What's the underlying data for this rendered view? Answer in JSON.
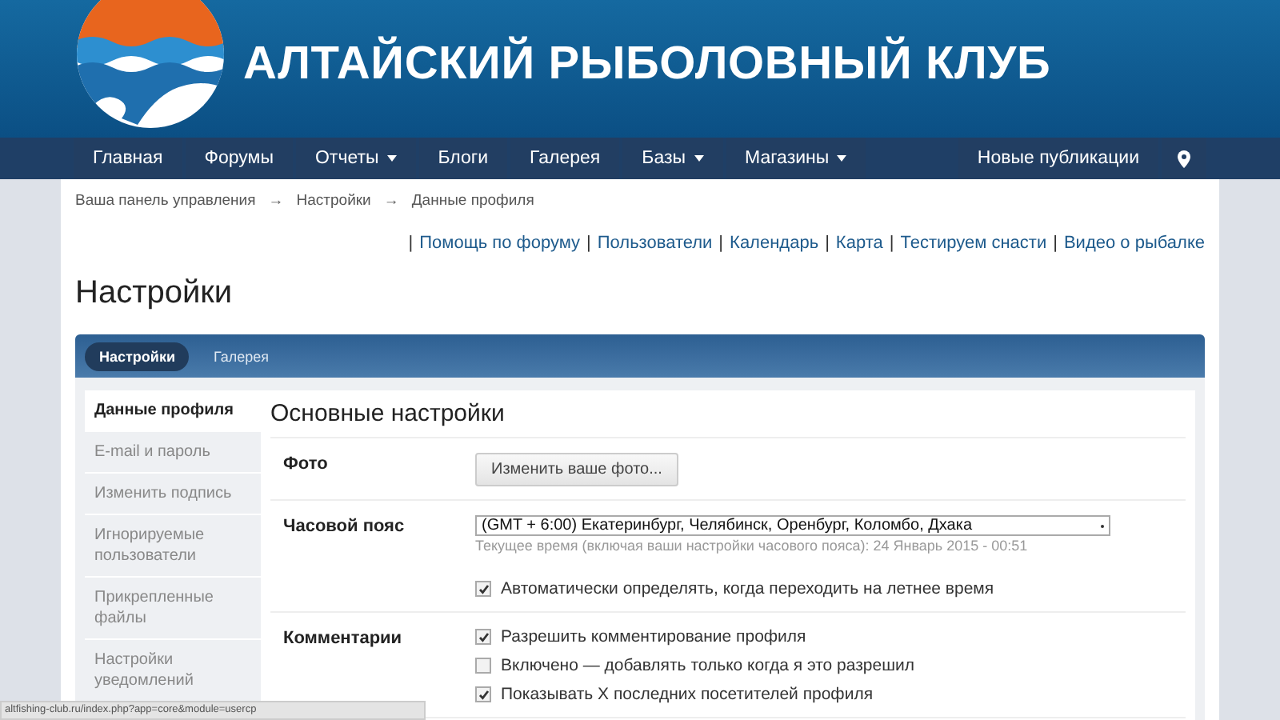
{
  "site_title": "АЛТАЙСКИЙ РЫБОЛОВНЫЙ КЛУБ",
  "nav": {
    "items": [
      {
        "label": "Главная",
        "dropdown": false
      },
      {
        "label": "Форумы",
        "dropdown": false
      },
      {
        "label": "Отчеты",
        "dropdown": true
      },
      {
        "label": "Блоги",
        "dropdown": false
      },
      {
        "label": "Галерея",
        "dropdown": false
      },
      {
        "label": "Базы",
        "dropdown": true
      },
      {
        "label": "Магазины",
        "dropdown": true
      }
    ],
    "right_items": [
      {
        "label": "Новые публикации"
      }
    ]
  },
  "breadcrumb": {
    "separator": "→",
    "items": [
      "Ваша панель управления",
      "Настройки",
      "Данные профиля"
    ]
  },
  "quick_links": {
    "separator": "|",
    "items": [
      "Помощь по форуму",
      "Пользователи",
      "Календарь",
      "Карта",
      "Тестируем снасти",
      "Видео о рыбалке"
    ]
  },
  "page_title": "Настройки",
  "tabs": [
    {
      "label": "Настройки",
      "selected": true
    },
    {
      "label": "Галерея",
      "selected": false
    }
  ],
  "sidebar": {
    "items": [
      {
        "label": "Данные профиля",
        "selected": true
      },
      {
        "label": "E-mail и пароль",
        "selected": false
      },
      {
        "label": "Изменить подпись",
        "selected": false
      },
      {
        "label": "Игнорируемые пользователи",
        "selected": false
      },
      {
        "label": "Прикрепленные файлы",
        "selected": false
      },
      {
        "label": "Настройки уведомлений",
        "selected": false
      }
    ]
  },
  "section_title": "Основные настройки",
  "rows": [
    {
      "label": "Фото",
      "controls": [
        {
          "kind": "button",
          "label": "Изменить ваше фото..."
        }
      ]
    },
    {
      "label": "Часовой пояс",
      "controls": [
        {
          "kind": "select",
          "value": "(GMT + 6:00) Екатеринбург, Челябинск, Оренбург, Коломбо, Дхака"
        },
        {
          "kind": "hint",
          "text": "Текущее время (включая ваши настройки часового пояса): 24 Январь 2015 - 00:51"
        },
        {
          "kind": "checkbox",
          "label": "Автоматически определять, когда переходить на летнее время",
          "checked": true
        }
      ]
    },
    {
      "label": "Комментарии",
      "controls": [
        {
          "kind": "checkbox",
          "label": "Разрешить комментирование профиля",
          "checked": true
        },
        {
          "kind": "checkbox",
          "label": "Включено — добавлять только когда я это разрешил",
          "checked": false
        },
        {
          "kind": "checkbox",
          "label": "Показывать X последних посетителей профиля",
          "checked": true
        }
      ]
    }
  ],
  "status_bar": {
    "url": "altfishing-club.ru/index.php?app=core&module=usercp"
  }
}
